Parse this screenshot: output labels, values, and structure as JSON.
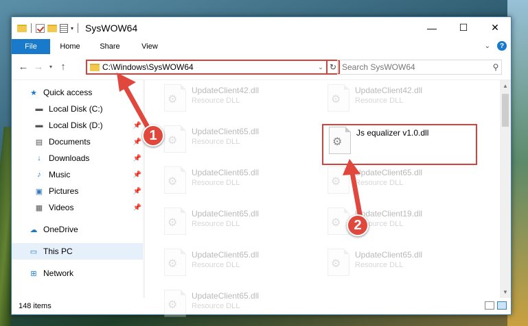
{
  "window": {
    "title": "SysWOW64",
    "controls": {
      "minimize": "—",
      "maximize": "☐",
      "close": "✕"
    }
  },
  "ribbon": {
    "file": "File",
    "tabs": [
      "Home",
      "Share",
      "View"
    ],
    "help": "?"
  },
  "navigation": {
    "address": "C:\\Windows\\SysWOW64",
    "search_placeholder": "Search SysWOW64"
  },
  "sidebar": {
    "quick_access": "Quick access",
    "quick_items": [
      {
        "label": "Local Disk (C:)",
        "icon": "drive-icon",
        "pinned": false
      },
      {
        "label": "Local Disk (D:)",
        "icon": "drive-icon",
        "pinned": true
      },
      {
        "label": "Documents",
        "icon": "documents-icon",
        "pinned": true
      },
      {
        "label": "Downloads",
        "icon": "downloads-icon",
        "pinned": true
      },
      {
        "label": "Music",
        "icon": "music-icon",
        "pinned": true
      },
      {
        "label": "Pictures",
        "icon": "pictures-icon",
        "pinned": true
      },
      {
        "label": "Videos",
        "icon": "videos-icon",
        "pinned": true
      }
    ],
    "onedrive": "OneDrive",
    "this_pc": "This PC",
    "network": "Network"
  },
  "files": {
    "col1": [
      {
        "name": "UpdateClient42.dll",
        "type": "Resource DLL"
      },
      {
        "name": "UpdateClient65.dll",
        "type": "Resource DLL"
      },
      {
        "name": "UpdateClient65.dll",
        "type": "Resource DLL"
      },
      {
        "name": "UpdateClient65.dll",
        "type": "Resource DLL"
      },
      {
        "name": "UpdateClient65.dll",
        "type": "Resource DLL"
      },
      {
        "name": "UpdateClient65.dll",
        "type": "Resource DLL"
      }
    ],
    "col2": [
      {
        "name": "UpdateClient42.dll",
        "type": "Resource DLL"
      },
      {
        "name": "UpdateClient65.dll",
        "type": "Resource DLL"
      },
      {
        "name": "UpdateClient19.dll",
        "type": "Resource DLL"
      },
      {
        "name": "UpdateClient65.dll",
        "type": "Resource DLL"
      }
    ],
    "highlighted": {
      "name": "Js equalizer v1.0.dll",
      "type": ""
    }
  },
  "status": {
    "item_count": "148 items"
  },
  "callouts": {
    "one": "1",
    "two": "2"
  },
  "colors": {
    "accent": "#1979ca",
    "highlight_red": "#d9403a",
    "callout_red": "#e0483e"
  }
}
